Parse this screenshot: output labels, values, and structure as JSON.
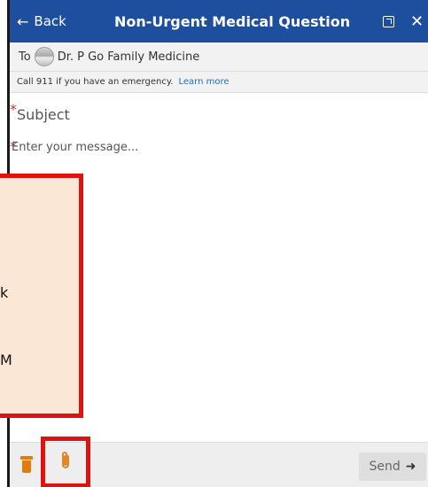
{
  "header": {
    "back_label": "Back",
    "back_arrow": "←",
    "title": "Non-Urgent Medical Question",
    "popout_icon": "popout-icon",
    "close_icon": "✕"
  },
  "recipient": {
    "to_label": "To",
    "name": "Dr. P Go Family Medicine"
  },
  "emergency": {
    "text": "Call 911 if you have an emergency.",
    "link": "Learn more"
  },
  "form": {
    "required_marker": "*",
    "subject_placeholder": "Subject",
    "message_placeholder": "Enter your message..."
  },
  "callout": {
    "line1": "k",
    "line2": "M"
  },
  "footer": {
    "delete_icon": "trash-icon",
    "attach_icon": "paperclip-icon",
    "send_label": "Send",
    "send_icon": "➜"
  },
  "colors": {
    "header_bg": "#1e4f9e",
    "accent_orange": "#e07b10",
    "highlight_red": "#e0120f",
    "callout_bg": "#fbe7d6",
    "required_red": "#c0392b",
    "link_blue": "#1e6fbf"
  }
}
